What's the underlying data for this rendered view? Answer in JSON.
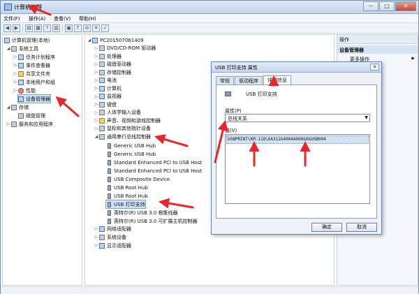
{
  "window": {
    "title": "计算机管理",
    "controls": [
      "－",
      "□",
      "✕"
    ]
  },
  "menu": {
    "items": [
      "文件(F)",
      "操作(A)",
      "查看(V)",
      "帮助(H)"
    ]
  },
  "left_tree": {
    "root": "计算机管理(本地)",
    "system_tools": "系统工具",
    "task_scheduler": "任务计划程序",
    "event_viewer": "事件查看器",
    "shared_folders": "共享文件夹",
    "local_users": "本地用户和组",
    "performance": "性能",
    "device_manager": "设备管理器",
    "storage": "存储",
    "disk_management": "磁盘管理",
    "services": "服务和应用程序"
  },
  "device_tree": {
    "computer": "PC201507061409",
    "categories": [
      "DVD/CD-ROM 驱动器",
      "处理器",
      "磁盘驱动器",
      "存储控制器",
      "电池",
      "计算机",
      "监视器",
      "键盘",
      "人体学输入设备",
      "声音、视频和游戏控制器",
      "鼠标和其他指针设备",
      "通用串行总线控制器"
    ],
    "usb_devices": [
      "Generic USB Hub",
      "Generic USB Hub",
      "Standard Enhanced PCI to USB Host",
      "Standard Enhanced PCI to USB Host",
      "USB Composite Device",
      "USB Root Hub",
      "USB Root Hub",
      "USB 打印支持",
      "英特尔(R) USB 3.0 根集线器",
      "英特尔(R) USB 3.0 可扩展主机控制器"
    ],
    "tail": [
      "网络适配器",
      "系统设备",
      "显示适配器"
    ]
  },
  "actions": {
    "header": "操作",
    "section": "设备管理器",
    "more": "更多操作",
    "more_arrow": "▶"
  },
  "dialog": {
    "title": "USB 打印支持 属性",
    "close": "✕",
    "tabs": [
      "常规",
      "驱动程序",
      "详细信息"
    ],
    "device_name": "USB 打印支持",
    "property_label": "属性(P)",
    "property_value": "总线关系",
    "value_label": "值(V)",
    "value_text": "USBPRINT\\KM-118\\6A312&4004A060&0&USB004",
    "ok": "确定",
    "cancel": "取消"
  },
  "accent": {
    "arrow": "#e8262c",
    "selection": "#cde4fb"
  }
}
